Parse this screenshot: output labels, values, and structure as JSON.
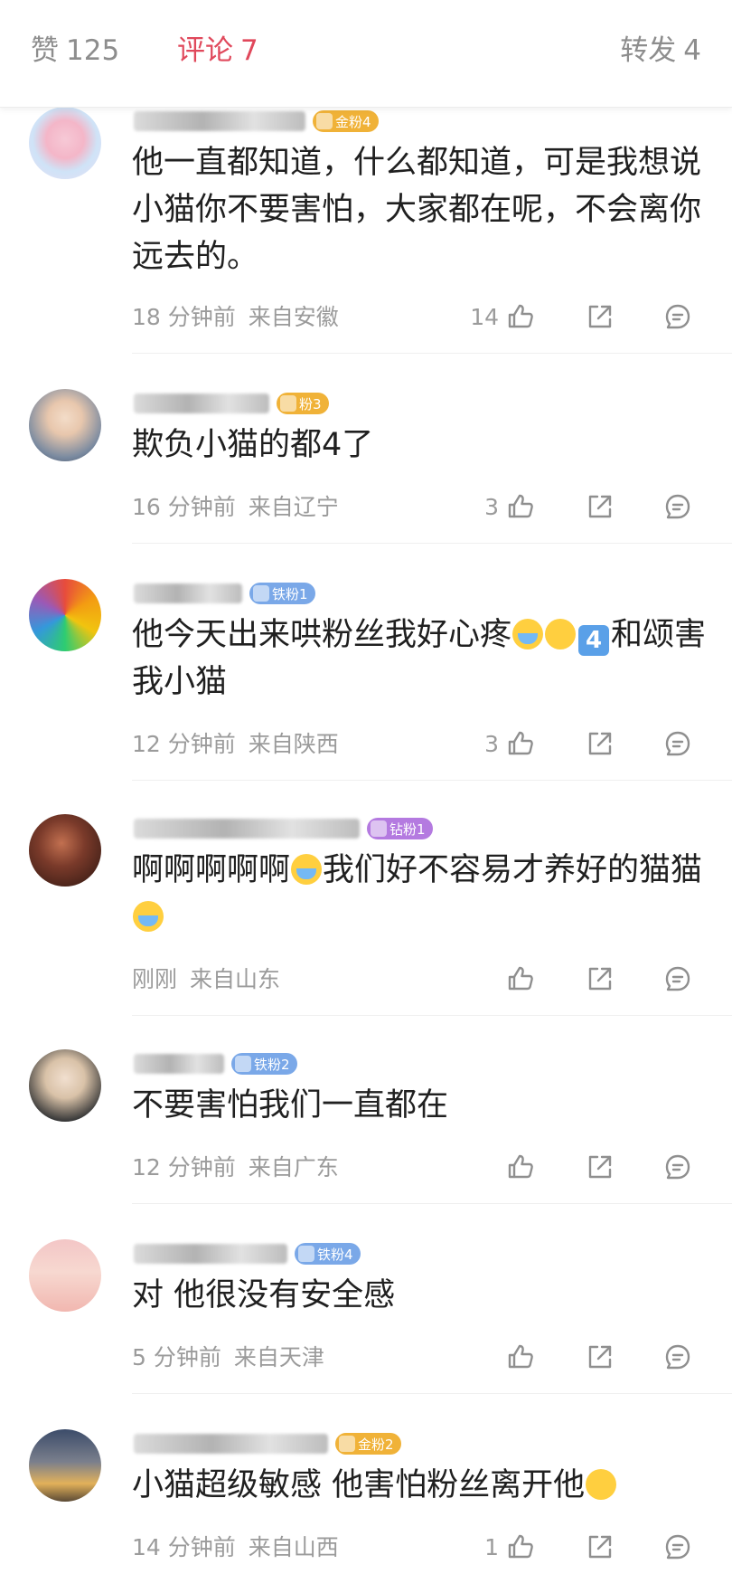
{
  "tabs": {
    "like": {
      "label": "赞",
      "count": "125"
    },
    "comment": {
      "label": "评论",
      "count": "7"
    },
    "repost": {
      "label": "转发",
      "count": "4"
    }
  },
  "colors": {
    "active_tab": "#e0485b",
    "inactive_text": "#8d8d8d",
    "meta_text": "#9b9b9b"
  },
  "comments": [
    {
      "badge": "金粉4",
      "badge_type": "gold",
      "text": "他一直都知道，什么都知道，可是我想说小猫你不要害怕，大家都在呢，不会离你远去的。",
      "time": "18 分钟前",
      "location": "来自安徽",
      "likes": "14"
    },
    {
      "badge": "粉3",
      "badge_type": "gold",
      "text": "欺负小猫的都4了",
      "time": "16 分钟前",
      "location": "来自辽宁",
      "likes": "3"
    },
    {
      "badge": "铁粉1",
      "badge_type": "iron",
      "text_a": "他今天出来哄粉丝我好心疼",
      "text_b": "4",
      "text_c": "和颂害我小猫",
      "time": "12 分钟前",
      "location": "来自陕西",
      "likes": "3"
    },
    {
      "badge": "钻粉1",
      "badge_type": "diamond",
      "text_a": "啊啊啊啊啊",
      "text_b": "我们好不容易才养好的猫猫",
      "time": "刚刚",
      "location": "来自山东",
      "likes": ""
    },
    {
      "badge": "铁粉2",
      "badge_type": "iron",
      "text": "不要害怕我们一直都在",
      "time": "12 分钟前",
      "location": "来自广东",
      "likes": ""
    },
    {
      "badge": "铁粉4",
      "badge_type": "iron",
      "text": "对 他很没有安全感",
      "time": "5 分钟前",
      "location": "来自天津",
      "likes": ""
    },
    {
      "badge": "金粉2",
      "badge_type": "gold",
      "text": "小猫超级敏感 他害怕粉丝离开他",
      "time": "14 分钟前",
      "location": "来自山西",
      "likes": "1"
    }
  ],
  "icons": [
    "like-icon",
    "share-icon",
    "reply-icon",
    "crying-emoji",
    "keycap-four-emoji"
  ]
}
